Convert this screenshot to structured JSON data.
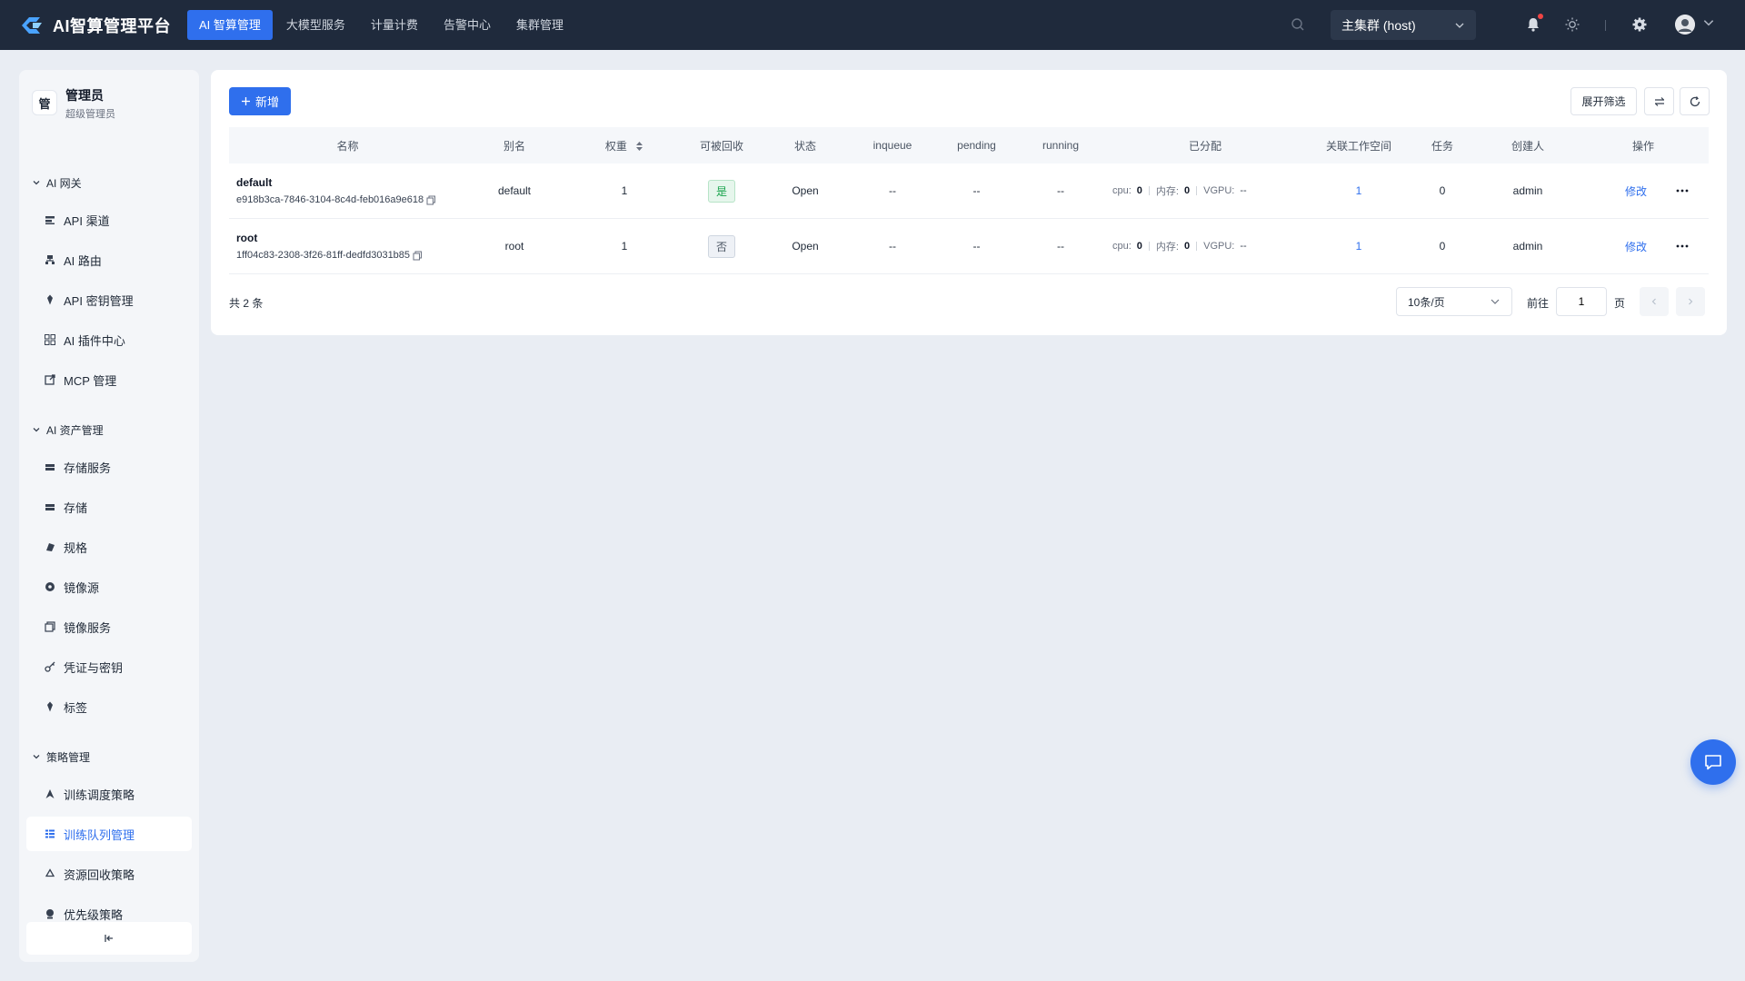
{
  "app": {
    "title": "AI智算管理平台"
  },
  "nav": {
    "items": [
      {
        "label": "AI 智算管理",
        "active": true
      },
      {
        "label": "大模型服务",
        "active": false
      },
      {
        "label": "计量计费",
        "active": false
      },
      {
        "label": "告警中心",
        "active": false
      },
      {
        "label": "集群管理",
        "active": false
      }
    ]
  },
  "cluster": {
    "selected": "主集群 (host)"
  },
  "user": {
    "avatar_char": "管",
    "name": "管理员",
    "role": "超级管理员"
  },
  "sidebar": {
    "groups": [
      {
        "title": "AI 网关",
        "items": [
          {
            "label": "API 渠道",
            "icon": "api-channel-icon"
          },
          {
            "label": "AI 路由",
            "icon": "route-icon"
          },
          {
            "label": "API 密钥管理",
            "icon": "key-icon"
          },
          {
            "label": "AI 插件中心",
            "icon": "grid-icon"
          },
          {
            "label": "MCP 管理",
            "icon": "external-link-icon"
          }
        ]
      },
      {
        "title": "AI 资产管理",
        "items": [
          {
            "label": "存储服务",
            "icon": "storage-icon"
          },
          {
            "label": "存储",
            "icon": "storage-icon"
          },
          {
            "label": "规格",
            "icon": "spec-icon"
          },
          {
            "label": "镜像源",
            "icon": "image-source-icon"
          },
          {
            "label": "镜像服务",
            "icon": "image-service-icon"
          },
          {
            "label": "凭证与密钥",
            "icon": "credential-icon"
          },
          {
            "label": "标签",
            "icon": "tag-icon"
          }
        ]
      },
      {
        "title": "策略管理",
        "items": [
          {
            "label": "训练调度策略",
            "icon": "schedule-icon"
          },
          {
            "label": "训练队列管理",
            "icon": "queue-icon",
            "active": true
          },
          {
            "label": "资源回收策略",
            "icon": "recycle-icon"
          },
          {
            "label": "优先级策略",
            "icon": "priority-icon"
          }
        ]
      }
    ]
  },
  "toolbar": {
    "new_label": "新增",
    "filter_label": "展开筛选"
  },
  "table": {
    "headers": {
      "name": "名称",
      "alias": "别名",
      "weight": "权重",
      "reclaimable": "可被回收",
      "status": "状态",
      "inqueue": "inqueue",
      "pending": "pending",
      "running": "running",
      "allocated": "已分配",
      "workspaces": "关联工作空间",
      "tasks": "任务",
      "creator": "创建人",
      "actions": "操作"
    },
    "rows": [
      {
        "name": "default",
        "id": "e918b3ca-7846-3104-8c4d-feb016a9e618",
        "alias": "default",
        "weight": "1",
        "reclaimable": "是",
        "status": "Open",
        "inqueue": "--",
        "pending": "--",
        "running": "--",
        "cpu_label": "cpu:",
        "cpu": "0",
        "mem_label": "内存:",
        "mem": "0",
        "vgpu_label": "VGPU:",
        "vgpu": "--",
        "workspaces": "1",
        "tasks": "0",
        "creator": "admin",
        "edit": "修改"
      },
      {
        "name": "root",
        "id": "1ff04c83-2308-3f26-81ff-dedfd3031b85",
        "alias": "root",
        "weight": "1",
        "reclaimable": "否",
        "status": "Open",
        "inqueue": "--",
        "pending": "--",
        "running": "--",
        "cpu_label": "cpu:",
        "cpu": "0",
        "mem_label": "内存:",
        "mem": "0",
        "vgpu_label": "VGPU:",
        "vgpu": "--",
        "workspaces": "1",
        "tasks": "0",
        "creator": "admin",
        "edit": "修改"
      }
    ]
  },
  "pager": {
    "total": "共 2 条",
    "page_size": "10条/页",
    "goto": "前往",
    "page": "1",
    "page_suffix": "页"
  },
  "colors": {
    "primary": "#2f6fed",
    "topbar": "#1f2a3c",
    "success": "#16a34a"
  }
}
